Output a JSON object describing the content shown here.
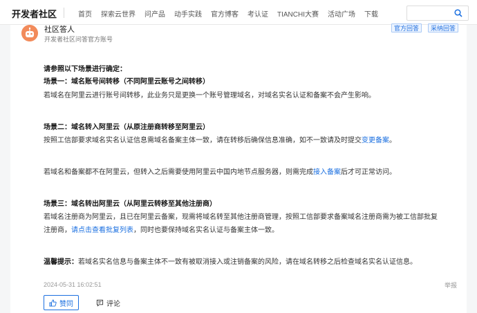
{
  "nav": {
    "brand": "开发者社区",
    "items": [
      "首页",
      "探索云世界",
      "问产品",
      "动手实践",
      "官方博客",
      "考认证",
      "TIANCHI大赛",
      "活动广场",
      "下载"
    ],
    "search_placeholder": ""
  },
  "answer": {
    "author": "社区答人",
    "author_desc": "开发者社区问答官方账号",
    "badges": [
      "官方回答",
      "采纳回答"
    ],
    "intro": "请参照以下场景进行确定：",
    "s1_title": "场景一：域名账号间转移（不同阿里云账号之间转移）",
    "s1_text": "若域名在阿里云进行账号间转移，此业务只是更换一个账号管理域名，对域名实名认证和备案不会产生影响。",
    "s2_title": "场景二：域名转入阿里云（从原注册商转移至阿里云）",
    "s2_text_a": "按照工信部要求域名实名认证信息需域名备案主体一致，请在转移后确保信息准确，如不一致请及时提交",
    "s2_link": "变更备案",
    "s2_text_b": "。",
    "s2b_text_a": "若域名和备案都不在阿里云，但转入之后需要使用阿里云中国内地节点服务器，则需完成",
    "s2b_link": "接入备案",
    "s2b_text_b": "后才可正常访问。",
    "s3_title": "场景三：域名转出阿里云（从阿里云转移至其他注册商）",
    "s3_text_1": "若域名注册商为阿里云，且已在阿里云备案，现需将域名转至其他注册商管理，按照工信部要求备案域名注册商需为被工信部批复",
    "s3_text_2a": "注册商，",
    "s3_link": "请点击查看批复列表",
    "s3_text_2b": "，同时也要保持域名实名认证与备案主体一致。",
    "tip_label": "温馨提示：",
    "tip_text": "若域名实名信息与备案主体不一致有被取消接入或注销备案的风险，请在域名转移之后检查域名实名认证信息。",
    "timestamp": "2024-05-31 16:02:51",
    "report": "举报",
    "like": "赞同",
    "comment": "评论"
  },
  "colors": {
    "accent": "#1a6fe0",
    "avatar": "#f28b5b"
  }
}
